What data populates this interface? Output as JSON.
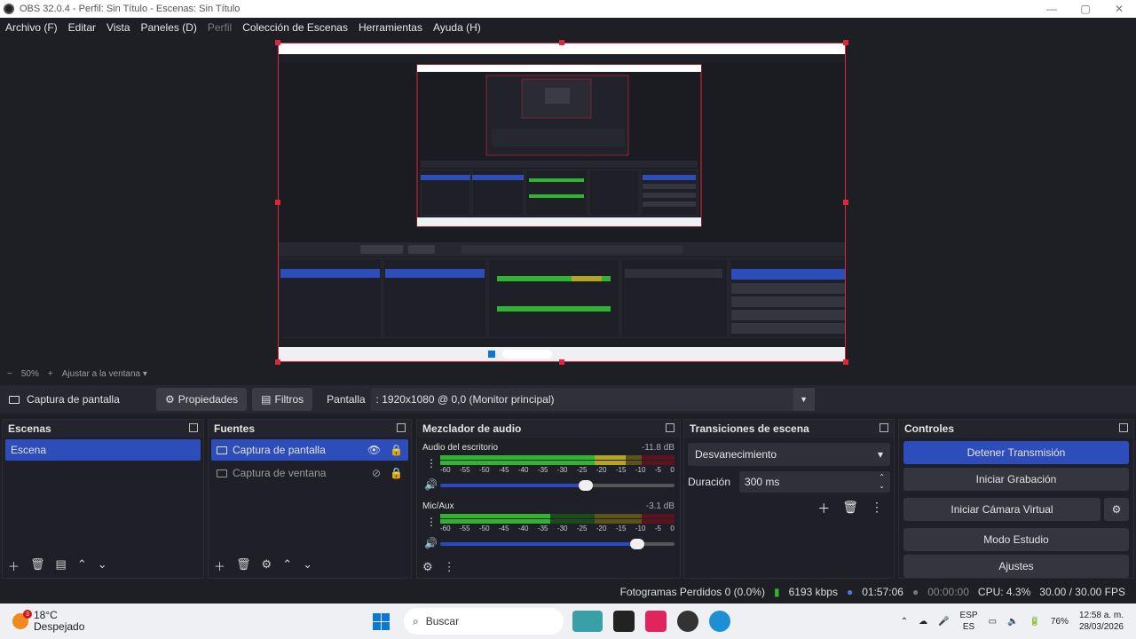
{
  "titlebar": {
    "title": "OBS 32.0.4 - Perfil: Sin Título - Escenas: Sin Título",
    "minimize": "—",
    "maximize": "▢",
    "close": "✕"
  },
  "menu": [
    "Archivo (F)",
    "Editar",
    "Vista",
    "Paneles (D)",
    "Perfil",
    "Colección de Escenas",
    "Herramientas",
    "Ayuda (H)"
  ],
  "zoom": {
    "minus": "−",
    "value": "50%",
    "plus": "+",
    "fit": "Ajustar a la ventana"
  },
  "source_bar": {
    "source": "Captura de pantalla",
    "properties": "Propiedades",
    "filters": "Filtros",
    "screen_label": "Pantalla",
    "screen_value": ": 1920x1080 @ 0,0 (Monitor principal)"
  },
  "scenes": {
    "title": "Escenas",
    "items": [
      "Escena"
    ]
  },
  "sources": {
    "title": "Fuentes",
    "items": [
      "Captura de pantalla",
      "Captura de ventana"
    ]
  },
  "mixer": {
    "title": "Mezclador de audio",
    "channels": [
      {
        "name": "Audio del escritorio",
        "db": "-11.8 dB",
        "level": 0.79,
        "volume": 0.62
      },
      {
        "name": "Mic/Aux",
        "db": "-3.1 dB",
        "level": 0.47,
        "volume": 0.84
      }
    ],
    "ticks": [
      "-60",
      "-55",
      "-50",
      "-45",
      "-40",
      "-35",
      "-30",
      "-25",
      "-20",
      "-15",
      "-10",
      "-5",
      "0"
    ]
  },
  "transitions": {
    "title": "Transiciones de escena",
    "type": "Desvanecimiento",
    "duration_label": "Duración",
    "duration_value": "300 ms"
  },
  "controls": {
    "title": "Controles",
    "buttons": [
      "Detener Transmisión",
      "Iniciar Grabación",
      "Iniciar Cámara Virtual",
      "Modo Estudio",
      "Ajustes"
    ]
  },
  "status": {
    "dropped": "Fotogramas Perdidos 0 (0.0%)",
    "bitrate": "6193 kbps",
    "live": "01:57:06",
    "rec": "00:00:00",
    "cpu": "CPU: 4.3%",
    "fps": "30.00 / 30.00 FPS"
  },
  "taskbar": {
    "temp": "18°C",
    "weather": "Despejado",
    "badge": "3",
    "search": "Buscar",
    "lang1": "ESP",
    "lang2": "ES",
    "battery": "76%",
    "time": "12:58 a. m.",
    "date": "28/03/2026"
  },
  "colors": {
    "accent": "#2d4dbb",
    "preview_border": "#e0263a",
    "meter_green": "#2fb52f",
    "meter_yellow": "#b4a522",
    "meter_red": "#a8182c"
  }
}
